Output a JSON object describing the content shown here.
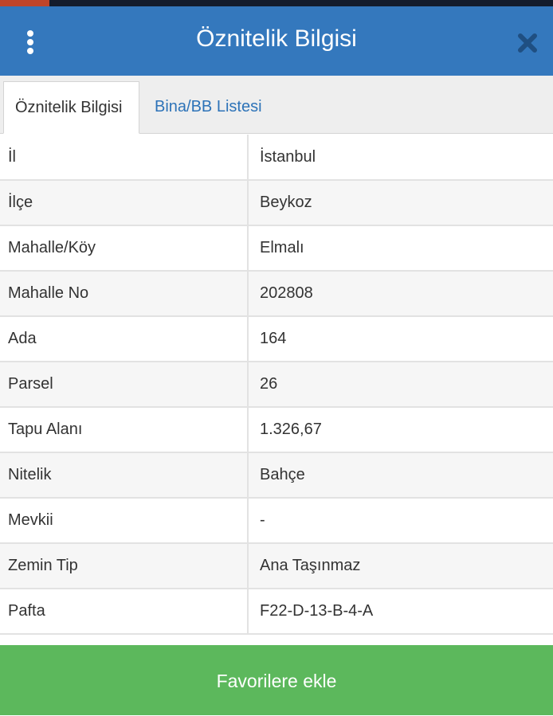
{
  "header": {
    "title": "Öznitelik Bilgisi",
    "menu_icon": "vertical-dots-icon",
    "close_icon": "close-icon",
    "color": "#3478bd"
  },
  "tabs": [
    {
      "label": "Öznitelik Bilgisi",
      "active": true
    },
    {
      "label": "Bina/BB Listesi",
      "active": false
    }
  ],
  "attributes": [
    {
      "key": "İl",
      "value": "İstanbul"
    },
    {
      "key": "İlçe",
      "value": "Beykoz"
    },
    {
      "key": "Mahalle/Köy",
      "value": "Elmalı"
    },
    {
      "key": "Mahalle No",
      "value": "202808"
    },
    {
      "key": "Ada",
      "value": "164"
    },
    {
      "key": "Parsel",
      "value": "26"
    },
    {
      "key": "Tapu Alanı",
      "value": "1.326,67"
    },
    {
      "key": "Nitelik",
      "value": "Bahçe"
    },
    {
      "key": "Mevkii",
      "value": "-"
    },
    {
      "key": "Zemin Tip",
      "value": "Ana Taşınmaz"
    },
    {
      "key": "Pafta",
      "value": "F22-D-13-B-4-A"
    }
  ],
  "footer": {
    "button_label": "Favorilere ekle",
    "color": "#5cb85c"
  }
}
